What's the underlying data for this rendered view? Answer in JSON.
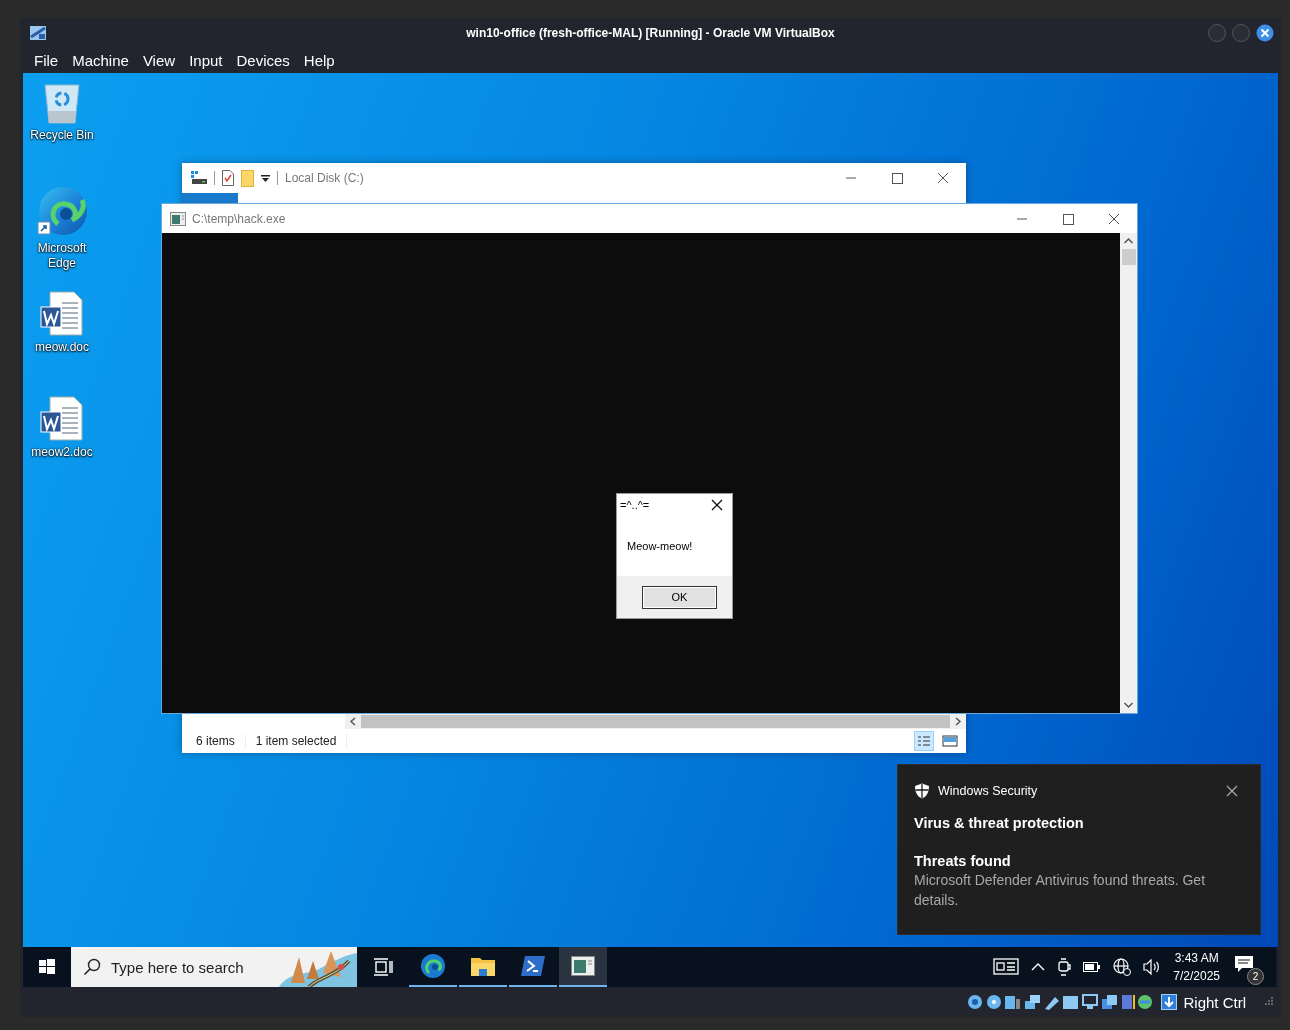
{
  "window": {
    "title": "win10-office (fresh-office-MAL) [Running] - Oracle VM VirtualBox"
  },
  "menu": [
    "File",
    "Machine",
    "View",
    "Input",
    "Devices",
    "Help"
  ],
  "desktop_icons": [
    {
      "label": "Recycle Bin",
      "kind": "recycle"
    },
    {
      "label": "Microsoft Edge",
      "kind": "edge"
    },
    {
      "label": "meow.doc",
      "kind": "doc"
    },
    {
      "label": "meow2.doc",
      "kind": "doc"
    }
  ],
  "explorer": {
    "title": "Local Disk (C:)",
    "status": [
      "6 items",
      "1 item selected"
    ]
  },
  "console": {
    "title": "C:\\temp\\hack.exe"
  },
  "message_box": {
    "title": "=^..^=",
    "text": "Meow-meow!",
    "button": "OK"
  },
  "notification": {
    "app": "Windows Security",
    "heading": "Virus & threat protection",
    "title": "Threats found",
    "body": "Microsoft Defender Antivirus found threats. Get details."
  },
  "taskbar": {
    "search_placeholder": "Type here to search",
    "apps": [
      {
        "kind": "edge",
        "running": true,
        "selected": false
      },
      {
        "kind": "explorer",
        "running": true,
        "selected": false
      },
      {
        "kind": "powershell",
        "running": true,
        "selected": false
      },
      {
        "kind": "console",
        "running": true,
        "selected": true
      }
    ],
    "time": "3:43 AM",
    "date": "7/2/2025",
    "notification_count": "2"
  },
  "status_bar": {
    "host_key": "Right Ctrl"
  }
}
